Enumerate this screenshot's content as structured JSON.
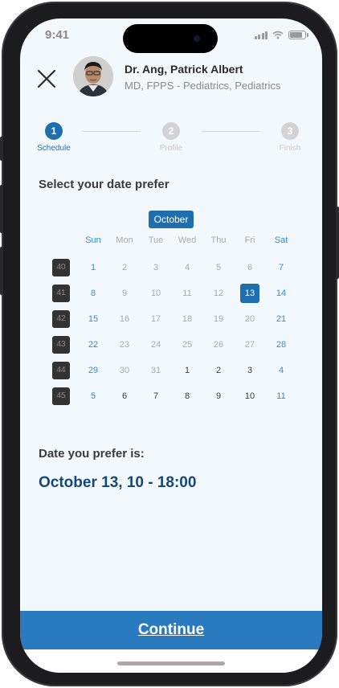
{
  "status_bar": {
    "time": "9:41"
  },
  "header": {
    "doctor_name": "Dr. Ang, Patrick Albert",
    "doctor_title": "MD, FPPS - Pediatrics, Pediatrics"
  },
  "stepper": {
    "steps": [
      {
        "number": "1",
        "label": "Schedule",
        "active": true
      },
      {
        "number": "2",
        "label": "Profile",
        "active": false
      },
      {
        "number": "3",
        "label": "Finish",
        "active": false
      }
    ]
  },
  "calendar": {
    "title": "Select your date prefer",
    "month": "October",
    "weekdays": [
      "Sun",
      "Mon",
      "Tue",
      "Wed",
      "Thu",
      "Fri",
      "Sat"
    ],
    "weeks": [
      {
        "week": "40",
        "days": [
          "1",
          "2",
          "3",
          "4",
          "5",
          "6",
          "7"
        ]
      },
      {
        "week": "41",
        "days": [
          "8",
          "9",
          "10",
          "11",
          "12",
          "13",
          "14"
        ]
      },
      {
        "week": "42",
        "days": [
          "15",
          "16",
          "17",
          "18",
          "19",
          "20",
          "21"
        ]
      },
      {
        "week": "43",
        "days": [
          "22",
          "23",
          "24",
          "25",
          "26",
          "27",
          "28"
        ]
      },
      {
        "week": "44",
        "days": [
          "29",
          "30",
          "31",
          "1",
          "2",
          "3",
          "4"
        ]
      },
      {
        "week": "45",
        "days": [
          "5",
          "6",
          "7",
          "8",
          "9",
          "10",
          "11"
        ]
      }
    ],
    "selected_day": "13"
  },
  "preference": {
    "label": "Date you prefer is:",
    "value": "October 13, 10 - 18:00"
  },
  "footer": {
    "continue_label": "Continue"
  },
  "colors": {
    "primary": "#1f6fae",
    "accent_blue": "#2b8fd3",
    "button": "#2a7abf",
    "dark_text": "#14477a",
    "background": "#f3f8fc"
  }
}
